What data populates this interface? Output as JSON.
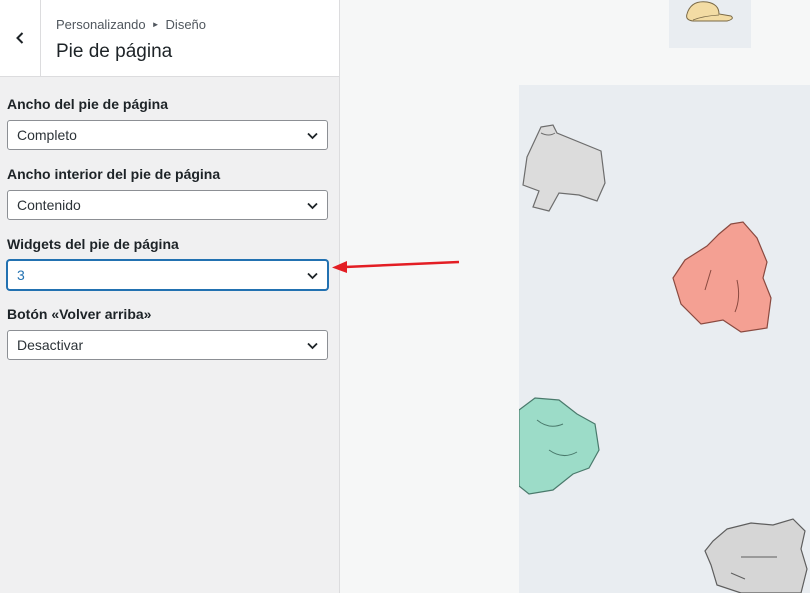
{
  "header": {
    "back_label": "Atrás",
    "breadcrumb": [
      "Personalizando",
      "Diseño"
    ],
    "title": "Pie de página"
  },
  "fields": [
    {
      "label": "Ancho del pie de página",
      "value": "Completo"
    },
    {
      "label": "Ancho interior del pie de página",
      "value": "Contenido"
    },
    {
      "label": "Widgets del pie de página",
      "value": "3"
    },
    {
      "label": "Botón «Volver arriba»",
      "value": "Desactivar"
    }
  ],
  "preview": {
    "items": [
      "cap-icon",
      "grey-tshirt-icon",
      "coral-sweater-icon",
      "mint-onesie-icon",
      "grey-hoodie-icon"
    ]
  },
  "colors": {
    "accent": "#2271b1",
    "arrow": "#e31e24",
    "panel_bg": "#f0f0f1",
    "preview_bg": "#e9edf1"
  }
}
